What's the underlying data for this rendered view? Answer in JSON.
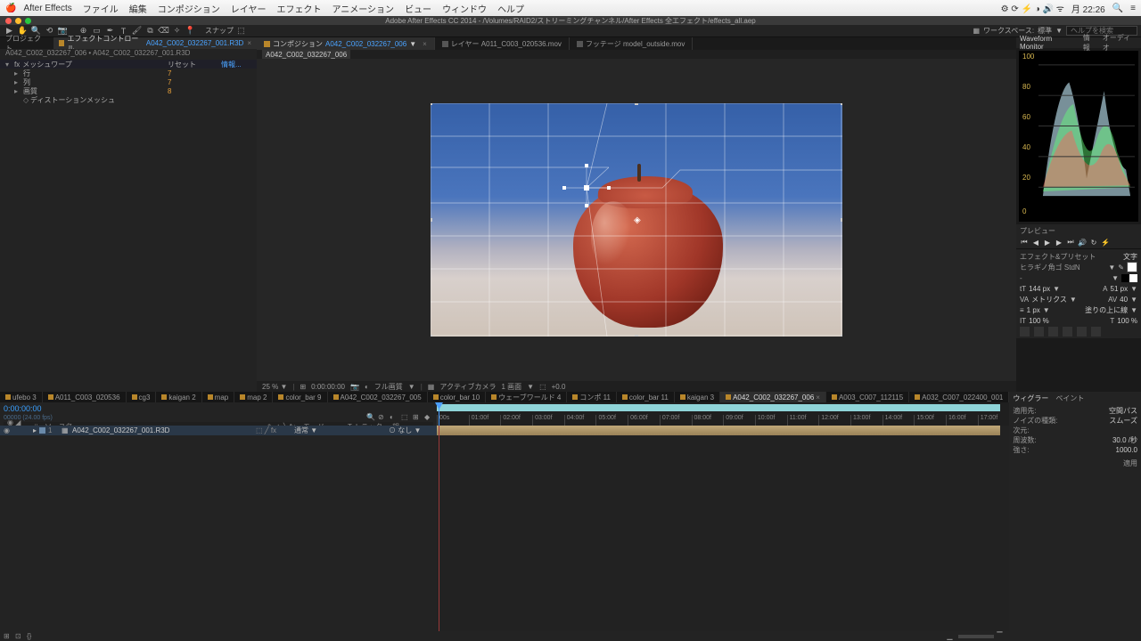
{
  "mac_menu": {
    "app": "After Effects",
    "items": [
      "ファイル",
      "編集",
      "コンポジション",
      "レイヤー",
      "エフェクト",
      "アニメーション",
      "ビュー",
      "ウィンドウ",
      "ヘルプ"
    ],
    "right": [
      "月 22:26"
    ]
  },
  "app_title": "Adobe After Effects CC 2014 - /Volumes/RAID2/ストリーミングチャンネル/After Effects 全エフェクト/effects_all.aep",
  "toolbar": {
    "snap": "スナップ",
    "workspace_label": "ワークスペース:",
    "workspace_value": "標準",
    "search_placeholder": "ヘルプを検索"
  },
  "effect_controls": {
    "tab_project": "プロジェクト",
    "tab_ec_prefix": "エフェクトコントロール",
    "tab_ec_layer": "A042_C002_032267_001.R3D",
    "breadcrumb": "A042_C002_032267_006 • A042_C002_032267_001.R3D",
    "effect_name": "メッシュワープ",
    "col_value": "リセット",
    "col_link": "情報...",
    "rows": [
      {
        "name": "行",
        "val": "7"
      },
      {
        "name": "列",
        "val": "7"
      },
      {
        "name": "画質",
        "val": "8"
      },
      {
        "name": "ディストーションメッシュ",
        "val": ""
      }
    ]
  },
  "comp": {
    "tabs": [
      {
        "label": "コンポジション",
        "name": "A042_C002_032267_006",
        "active": true
      },
      {
        "label": "レイヤー A011_C003_020536.mov",
        "active": false
      },
      {
        "label": "フッテージ model_outside.mov",
        "active": false
      }
    ],
    "subpath": "A042_C002_032267_006",
    "footer": {
      "zoom": "25 %",
      "time": "0:00:00:00",
      "res": "フル画質",
      "camera": "アクティブカメラ",
      "views": "1 画面",
      "alpha": "+0.0"
    }
  },
  "waveform": {
    "title": "Waveform Monitor",
    "tabs": [
      "情報",
      "オーディオ"
    ],
    "ticks": [
      "100",
      "80",
      "60",
      "40",
      "20",
      "0"
    ]
  },
  "preview": {
    "title": "プレビュー"
  },
  "char_panel": {
    "tab1": "エフェクト&プリセット",
    "tab2": "文字",
    "font": "ヒラギノ角ゴ StdN",
    "size": "144 px",
    "leading": "51 px",
    "metrics": "メトリクス",
    "tracking": "40",
    "stroke": "1 px",
    "stroke_pos": "塗りの上に線",
    "scale_v": "100 %",
    "scale_h": "100 %"
  },
  "timeline": {
    "tabs": [
      "ufebo 3",
      "A011_C003_020536",
      "cg3",
      "kaigan 2",
      "map",
      "map 2",
      "color_bar 9",
      "A042_C002_032267_005",
      "color_bar 10",
      "ウェーブワールド 4",
      "コンポ 11",
      "color_bar 11",
      "kaigan 3",
      "A042_C002_032267_006",
      "A003_C007_112115",
      "A032_C007_022400_001"
    ],
    "active_tab": 13,
    "timecode": "0:00:00:00",
    "timecode_sub": "00000 (24.00 fps)",
    "columns": [
      "#",
      "ソース名",
      "モード",
      "T トラック",
      "親"
    ],
    "layer": {
      "num": "1",
      "name": "A042_C002_032267_001.R3D",
      "mode": "通常",
      "parent": "なし"
    },
    "ruler_ticks": [
      "00s",
      "01:00f",
      "02:00f",
      "03:00f",
      "04:00f",
      "05:00f",
      "06:00f",
      "07:00f",
      "08:00f",
      "09:00f",
      "10:00f",
      "11:00f",
      "12:00f",
      "13:00f",
      "14:00f",
      "15:00f",
      "16:00f",
      "17:00f"
    ]
  },
  "wiggler": {
    "tab1": "ウィグラー",
    "tab2": "ペイント",
    "rows": [
      {
        "l": "適用先:",
        "v": "空間パス"
      },
      {
        "l": "ノイズの種類:",
        "v": "スムーズ"
      },
      {
        "l": "次元:",
        "v": ""
      },
      {
        "l": "周波数:",
        "v": "30.0  /秒"
      },
      {
        "l": "強さ:",
        "v": "1000.0"
      }
    ],
    "apply": "適用"
  }
}
